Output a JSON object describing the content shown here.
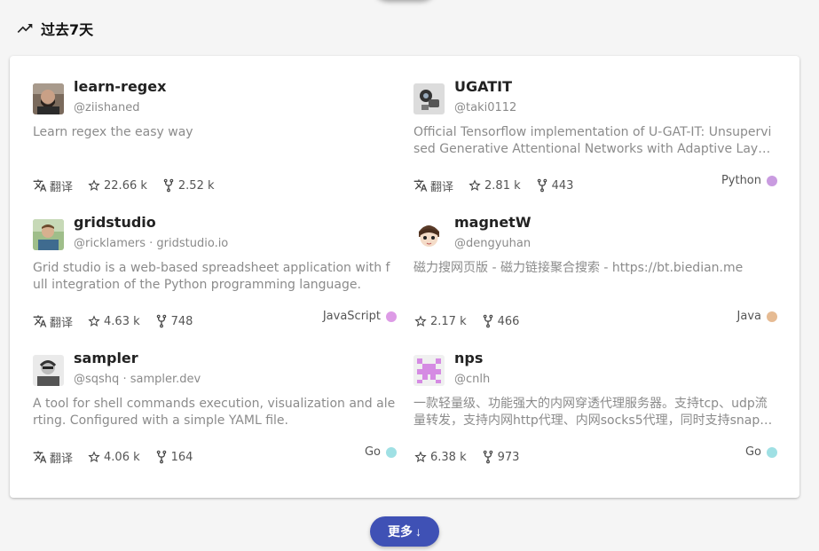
{
  "section": {
    "title": "过去7天"
  },
  "repos": [
    {
      "name": "learn-regex",
      "owner": "@ziishaned",
      "homepage": "",
      "description": "Learn regex the easy way",
      "translate_label": "翻译",
      "stars": "22.66 k",
      "forks": "2.52 k",
      "language": "",
      "language_color": ""
    },
    {
      "name": "UGATIT",
      "owner": "@taki0112",
      "homepage": "",
      "description": "Official Tensorflow implementation of U-GAT-IT: Unsupervised Generative Attentional Networks with Adaptive Layer-Instance Normalization",
      "translate_label": "翻译",
      "stars": "2.81 k",
      "forks": "443",
      "language": "Python",
      "language_color": "#c99be0"
    },
    {
      "name": "gridstudio",
      "owner": "@ricklamers",
      "homepage": "gridstudio.io",
      "description": "Grid studio is a web-based spreadsheet application with full integration of the Python programming language.",
      "translate_label": "翻译",
      "stars": "4.63 k",
      "forks": "748",
      "language": "JavaScript",
      "language_color": "#dd9be6"
    },
    {
      "name": "magnetW",
      "owner": "@dengyuhan",
      "homepage": "",
      "description": "磁力搜网页版 - 磁力链接聚合搜索 - https://bt.biedian.me",
      "translate_label": "",
      "stars": "2.17 k",
      "forks": "466",
      "language": "Java",
      "language_color": "#e6bb93"
    },
    {
      "name": "sampler",
      "owner": "@sqshq",
      "homepage": "sampler.dev",
      "description": "A tool for shell commands execution, visualization and alerting. Configured with a simple YAML file.",
      "translate_label": "翻译",
      "stars": "4.06 k",
      "forks": "164",
      "language": "Go",
      "language_color": "#9fe0e4"
    },
    {
      "name": "nps",
      "owner": "@cnlh",
      "homepage": "",
      "description": "一款轻量级、功能强大的内网穿透代理服务器。支持tcp、udp流量转发，支持内网http代理、内网socks5代理，同时支持snappy压缩、站点保护、加密传输、多路复用、header修改等。支持web图形化管理，集成多用户模式。",
      "translate_label": "",
      "stars": "6.38 k",
      "forks": "973",
      "language": "Go",
      "language_color": "#9fe0e4"
    }
  ],
  "more_button": {
    "label": "更多",
    "arrow": "↓"
  },
  "colors": {
    "accent": "#3f51b5"
  }
}
